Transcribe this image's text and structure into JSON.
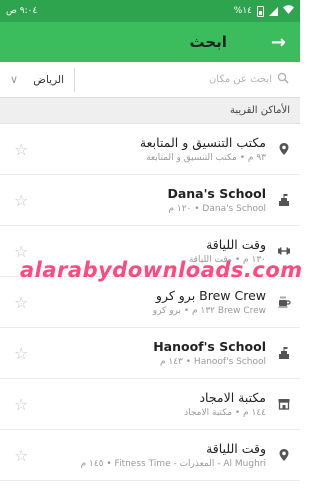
{
  "status_bar": {
    "time": "٩:٠٤ ص",
    "battery": "%١٤"
  },
  "app_bar": {
    "title": "ابحث",
    "back_icon": "arrow-right-icon"
  },
  "search": {
    "placeholder": "ابحث عن مكان",
    "city": "الرياض"
  },
  "section_header": "الأماكن القريبة",
  "places": [
    {
      "title": "مكتب التنسيق و المتابعة",
      "subtitle": "٩٣ م • مكتب التنسيق و المتابعة",
      "icon": "location-pin-icon",
      "bold": false
    },
    {
      "title": "Dana's School",
      "subtitle": "١٢٠ م • Dana's School",
      "icon": "school-icon",
      "bold": true
    },
    {
      "title": "وقت اللياقة",
      "subtitle": "١٣٠ م • وقت اللياقة",
      "icon": "dumbbell-icon",
      "bold": false
    },
    {
      "title": "برو كرو Brew Crew",
      "subtitle": "١٣٢ م • برو كرو Brew Crew",
      "icon": "coffee-cup-icon",
      "bold": false
    },
    {
      "title": "Hanoof's School",
      "subtitle": "١٤٣ م • Hanoof's School",
      "icon": "school-icon",
      "bold": true
    },
    {
      "title": "مكتبة الامجاد",
      "subtitle": "١٤٤ م • مكتبة الامجاد",
      "icon": "store-icon",
      "bold": false
    },
    {
      "title": "وقت اللياقة",
      "subtitle": "١٤٥ م • Fitness Time - المعذرات - Al Mughri",
      "icon": "location-pin-icon",
      "bold": false
    }
  ],
  "watermark": "alarabydownloads.com"
}
